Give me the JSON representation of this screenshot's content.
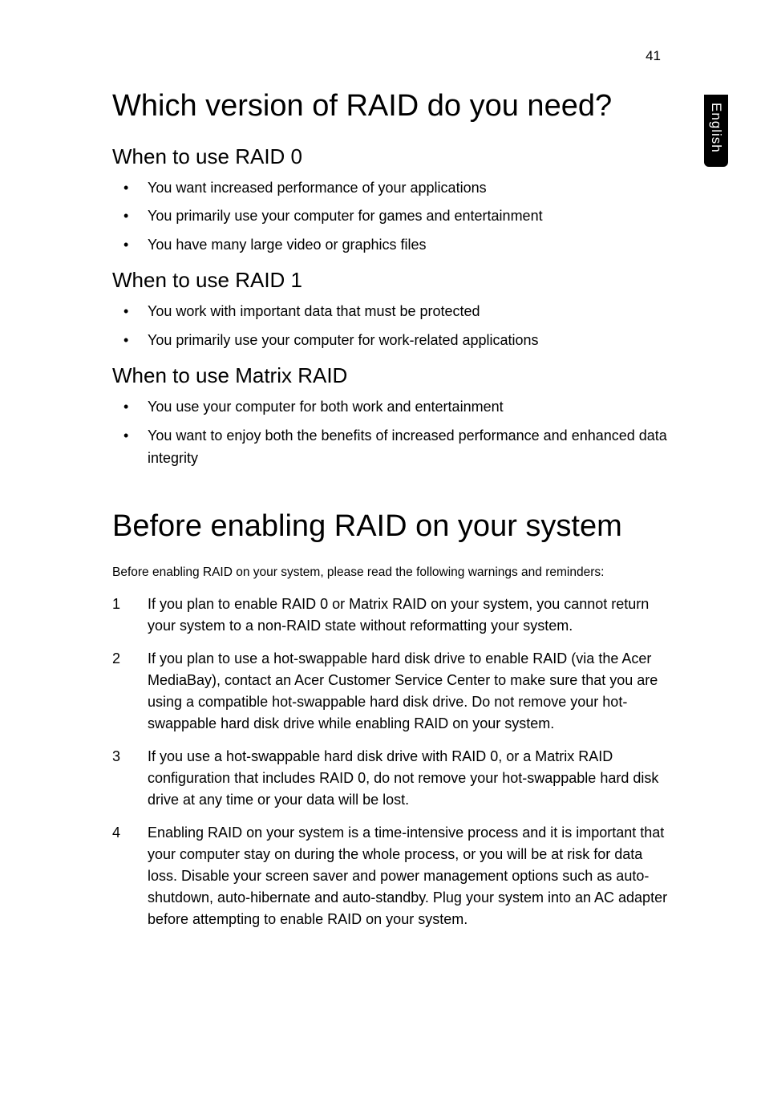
{
  "page_number": "41",
  "side_tab": "English",
  "h1_a": "Which version of RAID do you need?",
  "sec_a": {
    "h2": "When to use RAID 0",
    "items": [
      "You want increased performance of your applications",
      "You primarily use your computer for games and entertainment",
      "You have many large video or graphics files"
    ]
  },
  "sec_b": {
    "h2": "When to use RAID 1",
    "items": [
      "You work with important data that must be protected",
      "You primarily use your computer for work-related applications"
    ]
  },
  "sec_c": {
    "h2": "When to use Matrix RAID",
    "items": [
      "You use your computer for both work and entertainment",
      "You want to enjoy both the benefits of increased performance and enhanced data integrity"
    ]
  },
  "h1_b": "Before enabling RAID on your system",
  "lead": "Before enabling RAID on your system, please read the following warnings and reminders:",
  "ol": [
    {
      "n": "1",
      "t": "If you plan to enable RAID 0 or Matrix RAID on your system, you cannot return your system to a non-RAID state without reformatting your system."
    },
    {
      "n": "2",
      "t": "If you plan to use a hot-swappable hard disk drive to enable RAID (via the Acer MediaBay), contact an Acer Customer Service Center to make sure that you are using a compatible hot-swappable hard disk drive. Do not remove your hot-swappable hard disk drive while enabling RAID on your system."
    },
    {
      "n": "3",
      "t": "If you use a hot-swappable hard disk drive with RAID 0, or a Matrix RAID configuration that includes RAID 0, do not remove your hot-swappable hard disk drive at any time or your data will be lost."
    },
    {
      "n": "4",
      "t": "Enabling RAID on your system is a time-intensive process and it is important that your computer stay on during the whole process, or you will be at risk for data loss. Disable your screen saver and power management options such as auto-shutdown, auto-hibernate and auto-standby. Plug your system into an AC adapter before attempting to enable RAID on your system."
    }
  ]
}
